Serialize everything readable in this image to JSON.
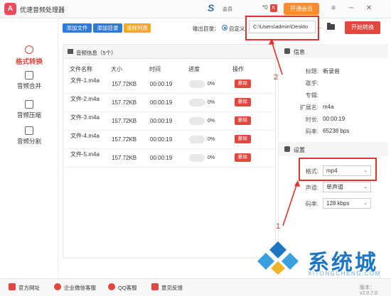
{
  "titlebar": {
    "logo_char": "A",
    "app_title": "优速音频处理器",
    "s_logo": "S",
    "member_label": "会员",
    "vip_count": "*0",
    "vip_icon": "K",
    "vip_button": "开通会员",
    "menu_icon": "≡",
    "min_icon": "─",
    "close_icon": "✕"
  },
  "sidebar": {
    "items": [
      {
        "label": "格式转换",
        "icon": "convert-icon",
        "active": true
      },
      {
        "label": "音频合并",
        "icon": "merge-icon",
        "active": false
      },
      {
        "label": "音频压缩",
        "icon": "compress-icon",
        "active": false
      },
      {
        "label": "音频分割",
        "icon": "split-icon",
        "active": false
      }
    ]
  },
  "toolbar": {
    "add_file": "添加文件",
    "add_folder": "添加目录",
    "clear_list": "清除列表",
    "output_label": "输出目录：",
    "radio_label": "自定义",
    "path_value": "C:\\Users\\admin\\Deskto",
    "dots": "…",
    "start_button": "开始转换",
    "colors": {
      "blue": "#2d7bd6",
      "orange": "#f5a623",
      "red": "#e3463c"
    }
  },
  "file_list": {
    "title": "音频信息（5个）",
    "columns": [
      "文件名称",
      "大小",
      "时间",
      "进度",
      "操作"
    ],
    "rows": [
      {
        "name": "文件-1.m4a",
        "size": "157.72KB",
        "time": "00:00:19",
        "progress": "0%",
        "action": "删除"
      },
      {
        "name": "文件-2.m4a",
        "size": "157.72KB",
        "time": "00:00:19",
        "progress": "0%",
        "action": "删除"
      },
      {
        "name": "文件-3.m4a",
        "size": "157.72KB",
        "time": "00:00:19",
        "progress": "0%",
        "action": "删除"
      },
      {
        "name": "文件-4.m4a",
        "size": "157.72KB",
        "time": "00:00:19",
        "progress": "0%",
        "action": "删除"
      },
      {
        "name": "文件-5.m4a",
        "size": "157.72KB",
        "time": "00:00:19",
        "progress": "0%",
        "action": "删除"
      }
    ]
  },
  "info": {
    "title": "信息",
    "fields": [
      {
        "key": "标题:",
        "value": "新录音"
      },
      {
        "key": "歌手:",
        "value": ""
      },
      {
        "key": "专辑:",
        "value": ""
      },
      {
        "key": "扩展名:",
        "value": "m4a"
      },
      {
        "key": "时长:",
        "value": "00:00:19"
      },
      {
        "key": "码率:",
        "value": "65238 bps"
      }
    ]
  },
  "settings": {
    "title": "设置",
    "format_key": "格式:",
    "format_value": "mp4",
    "channel_key": "声道:",
    "channel_value": "单声道",
    "bitrate_key": "码率:",
    "bitrate_value": "128 kbps"
  },
  "annotations": {
    "num1": "1",
    "num2": "2"
  },
  "bottombar": {
    "items": [
      {
        "label": "官方网址",
        "color": "#e3463c"
      },
      {
        "label": "企业微信客服",
        "color": "#e3463c"
      },
      {
        "label": "QQ客服",
        "color": "#e3463c"
      },
      {
        "label": "意见反馈",
        "color": "#e3463c"
      }
    ],
    "version": "版本：v2.0.7.0"
  },
  "watermark": {
    "text": "系统城",
    "url": "XITONGCHENG.COM"
  }
}
